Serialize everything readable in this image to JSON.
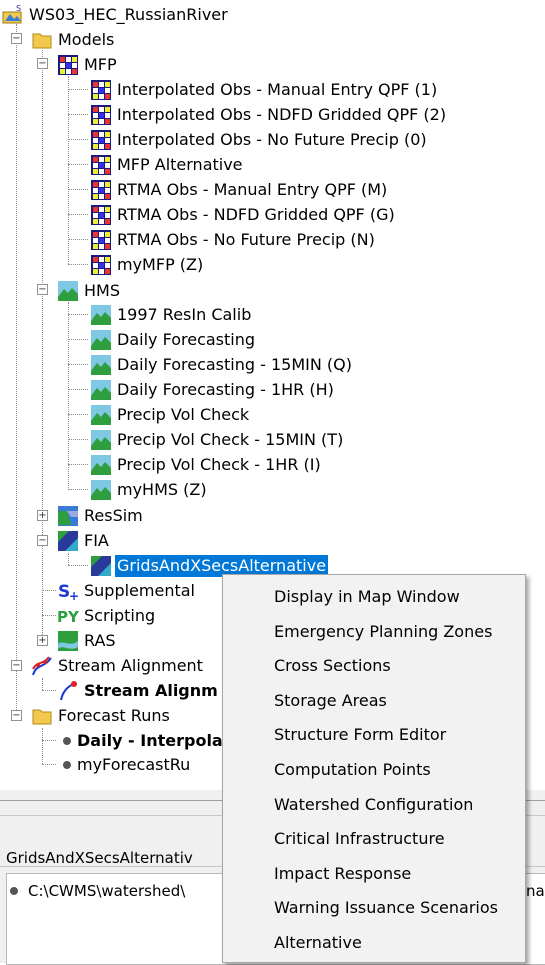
{
  "tree": {
    "root": "WS03_HEC_RussianRiver",
    "models": "Models",
    "mfp": {
      "label": "MFP",
      "items": [
        "Interpolated Obs - Manual Entry QPF (1)",
        "Interpolated Obs - NDFD Gridded QPF (2)",
        "Interpolated Obs - No Future Precip (0)",
        "MFP Alternative",
        "RTMA Obs - Manual Entry QPF (M)",
        "RTMA Obs - NDFD Gridded QPF (G)",
        "RTMA Obs - No Future Precip (N)",
        "myMFP (Z)"
      ]
    },
    "hms": {
      "label": "HMS",
      "items": [
        "1997 ResIn Calib",
        "Daily Forecasting",
        "Daily Forecasting - 15MIN (Q)",
        "Daily Forecasting - 1HR (H)",
        "Precip Vol Check",
        "Precip Vol Check - 15MIN (T)",
        "Precip Vol Check - 1HR (I)",
        "myHMS (Z)"
      ]
    },
    "ressim": "ResSim",
    "fia": "FIA",
    "fia_item": "GridsAndXSecsAlternative",
    "supplemental": "Supplemental",
    "scripting": "Scripting",
    "ras": "RAS",
    "stream_alignments": "Stream Alignment",
    "stream_alignment_item": "Stream Alignm",
    "forecast_runs": "Forecast Runs",
    "forecast_items": [
      "Daily - Interpola",
      "myForecastRu"
    ]
  },
  "bottom": {
    "tab_label": "GridsAndXSecsAlternativ",
    "path": "C:\\CWMS\\watershed\\",
    "right_fragment": "nat"
  },
  "context_menu": {
    "items": [
      "Display in Map Window",
      "Emergency Planning Zones",
      "Cross Sections",
      "Storage Areas",
      "Structure Form Editor",
      "Computation Points",
      "Watershed Configuration",
      "Critical Infrastructure",
      "Impact Response",
      "Warning Issuance Scenarios",
      "Alternative"
    ]
  },
  "colors": {
    "selection": "#0078d7",
    "menu_bg": "#f2f2f2",
    "folder": "#f2c94c"
  }
}
